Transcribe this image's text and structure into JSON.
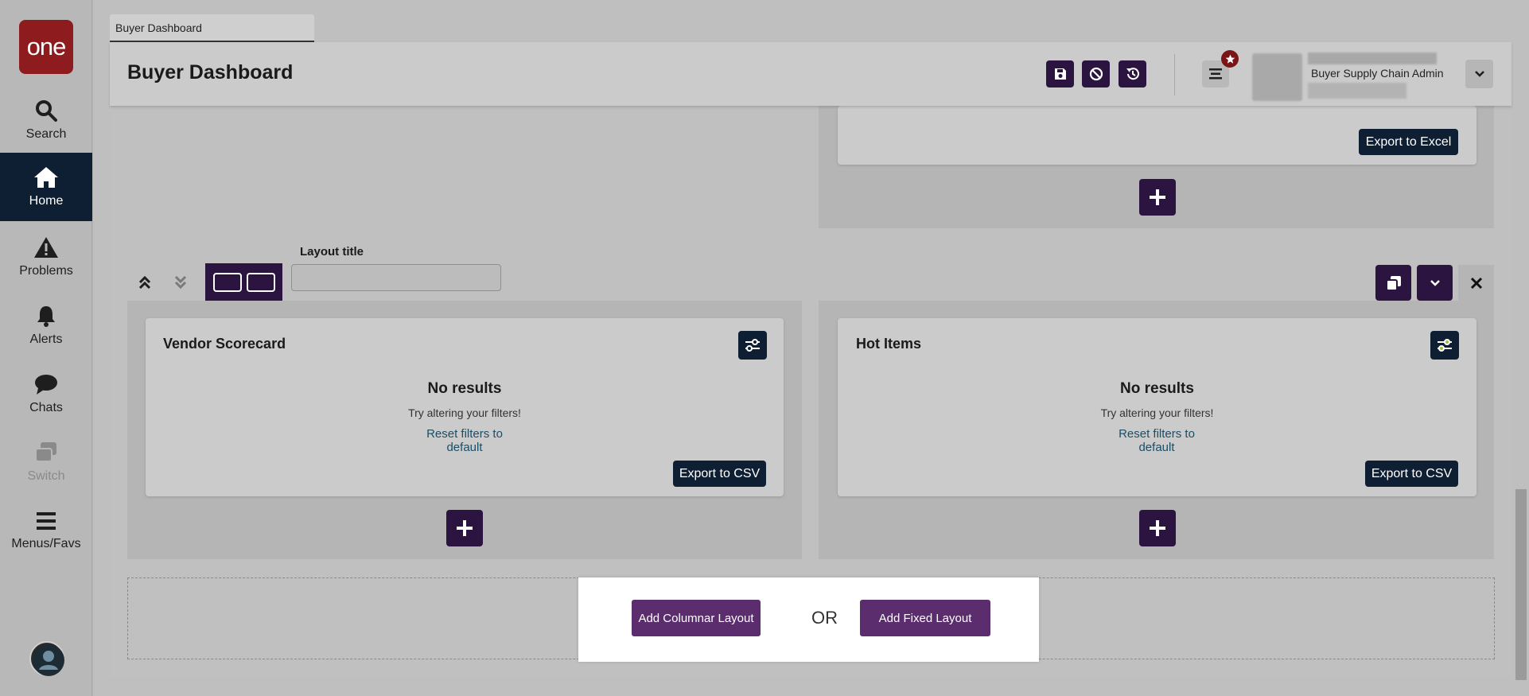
{
  "sidebar": {
    "logo": "one",
    "items": [
      {
        "label": "Search",
        "icon": "search-icon"
      },
      {
        "label": "Home",
        "icon": "home-icon"
      },
      {
        "label": "Problems",
        "icon": "warning-icon"
      },
      {
        "label": "Alerts",
        "icon": "bell-icon"
      },
      {
        "label": "Chats",
        "icon": "chat-icon"
      },
      {
        "label": "Switch",
        "icon": "switch-icon"
      },
      {
        "label": "Menus/Favs",
        "icon": "menu-icon"
      }
    ],
    "active_item": "Home",
    "disabled_item": "Switch"
  },
  "tab": {
    "label": "Buyer Dashboard"
  },
  "header": {
    "title": "Buyer Dashboard",
    "user_role": "Buyer Supply Chain Admin"
  },
  "top_right_card": {
    "export_label": "Export to Excel"
  },
  "layout": {
    "title_label": "Layout title",
    "title_value": ""
  },
  "cards": [
    {
      "title": "Vendor Scorecard",
      "no_results": "No results",
      "hint": "Try altering your filters!",
      "reset": "Reset filters to default",
      "export_label": "Export to CSV"
    },
    {
      "title": "Hot Items",
      "no_results": "No results",
      "hint": "Try altering your filters!",
      "reset": "Reset filters to default",
      "export_label": "Export to CSV"
    }
  ],
  "add_layout": {
    "columnar_label": "Add Columnar Layout",
    "or": "OR",
    "fixed_label": "Add Fixed Layout"
  },
  "colors": {
    "accent": "#2b1440",
    "brand": "#8e1b1e",
    "nav_active": "#0f1f33",
    "add_button": "#5b2d6e"
  }
}
